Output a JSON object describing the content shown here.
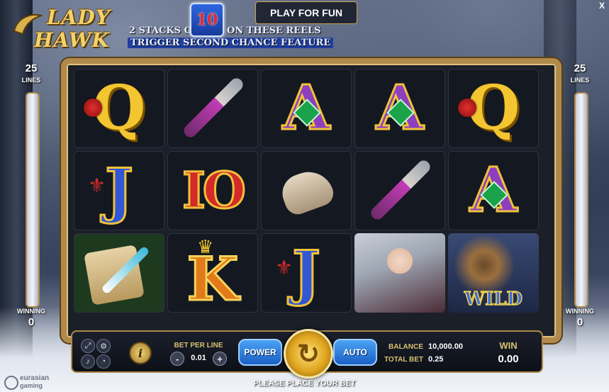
{
  "game": {
    "logo_line1": "LADY",
    "logo_line2": "HAWK",
    "banner_pre": "2 STACKS OF",
    "banner_badge": "10",
    "banner_post": "ON THESE REELS",
    "banner_line2": "TRIGGER SECOND CHANCE FEATURE",
    "play_for_fun": "PLAY FOR FUN",
    "close_label": "X"
  },
  "left_panel": {
    "lines": "25",
    "lines_label": "LINES",
    "winning_label": "WINNING",
    "winning_value": "0"
  },
  "right_panel": {
    "lines": "25",
    "lines_label": "LINES",
    "winning_label": "WINNING",
    "winning_value": "0"
  },
  "reels": [
    [
      "Q",
      "dagger",
      "A",
      "A",
      "Q"
    ],
    [
      "J",
      "10",
      "glove",
      "dagger",
      "A"
    ],
    [
      "scroll",
      "K",
      "J",
      "lady",
      "WILD"
    ]
  ],
  "symbol_text": {
    "Q": "Q",
    "A": "A",
    "J": "J",
    "10": "IO",
    "K": "K",
    "WILD": "WILD"
  },
  "bottom": {
    "info_label": "i",
    "bet_per_line_label": "BET PER LINE",
    "bet_minus": "-",
    "bet_per_line_value": "0.01",
    "bet_plus": "+",
    "power_label": "POWER",
    "spin_icon": "↻",
    "auto_label": "AUTO",
    "balance_label": "BALANCE",
    "balance_value": "10,000.00",
    "total_bet_label": "TOTAL BET",
    "total_bet_value": "0.25",
    "win_label": "WIN",
    "win_value": "0.00"
  },
  "status_text": "PLEASE PLACE YOUR BET",
  "brand": {
    "line1": "eurasian",
    "line2": "gaming"
  },
  "colors": {
    "gold": "#b08a4a",
    "spin_gold": "#e0a51e",
    "pill_blue": "#1a5fc5",
    "label_gold": "#d7c06f"
  }
}
